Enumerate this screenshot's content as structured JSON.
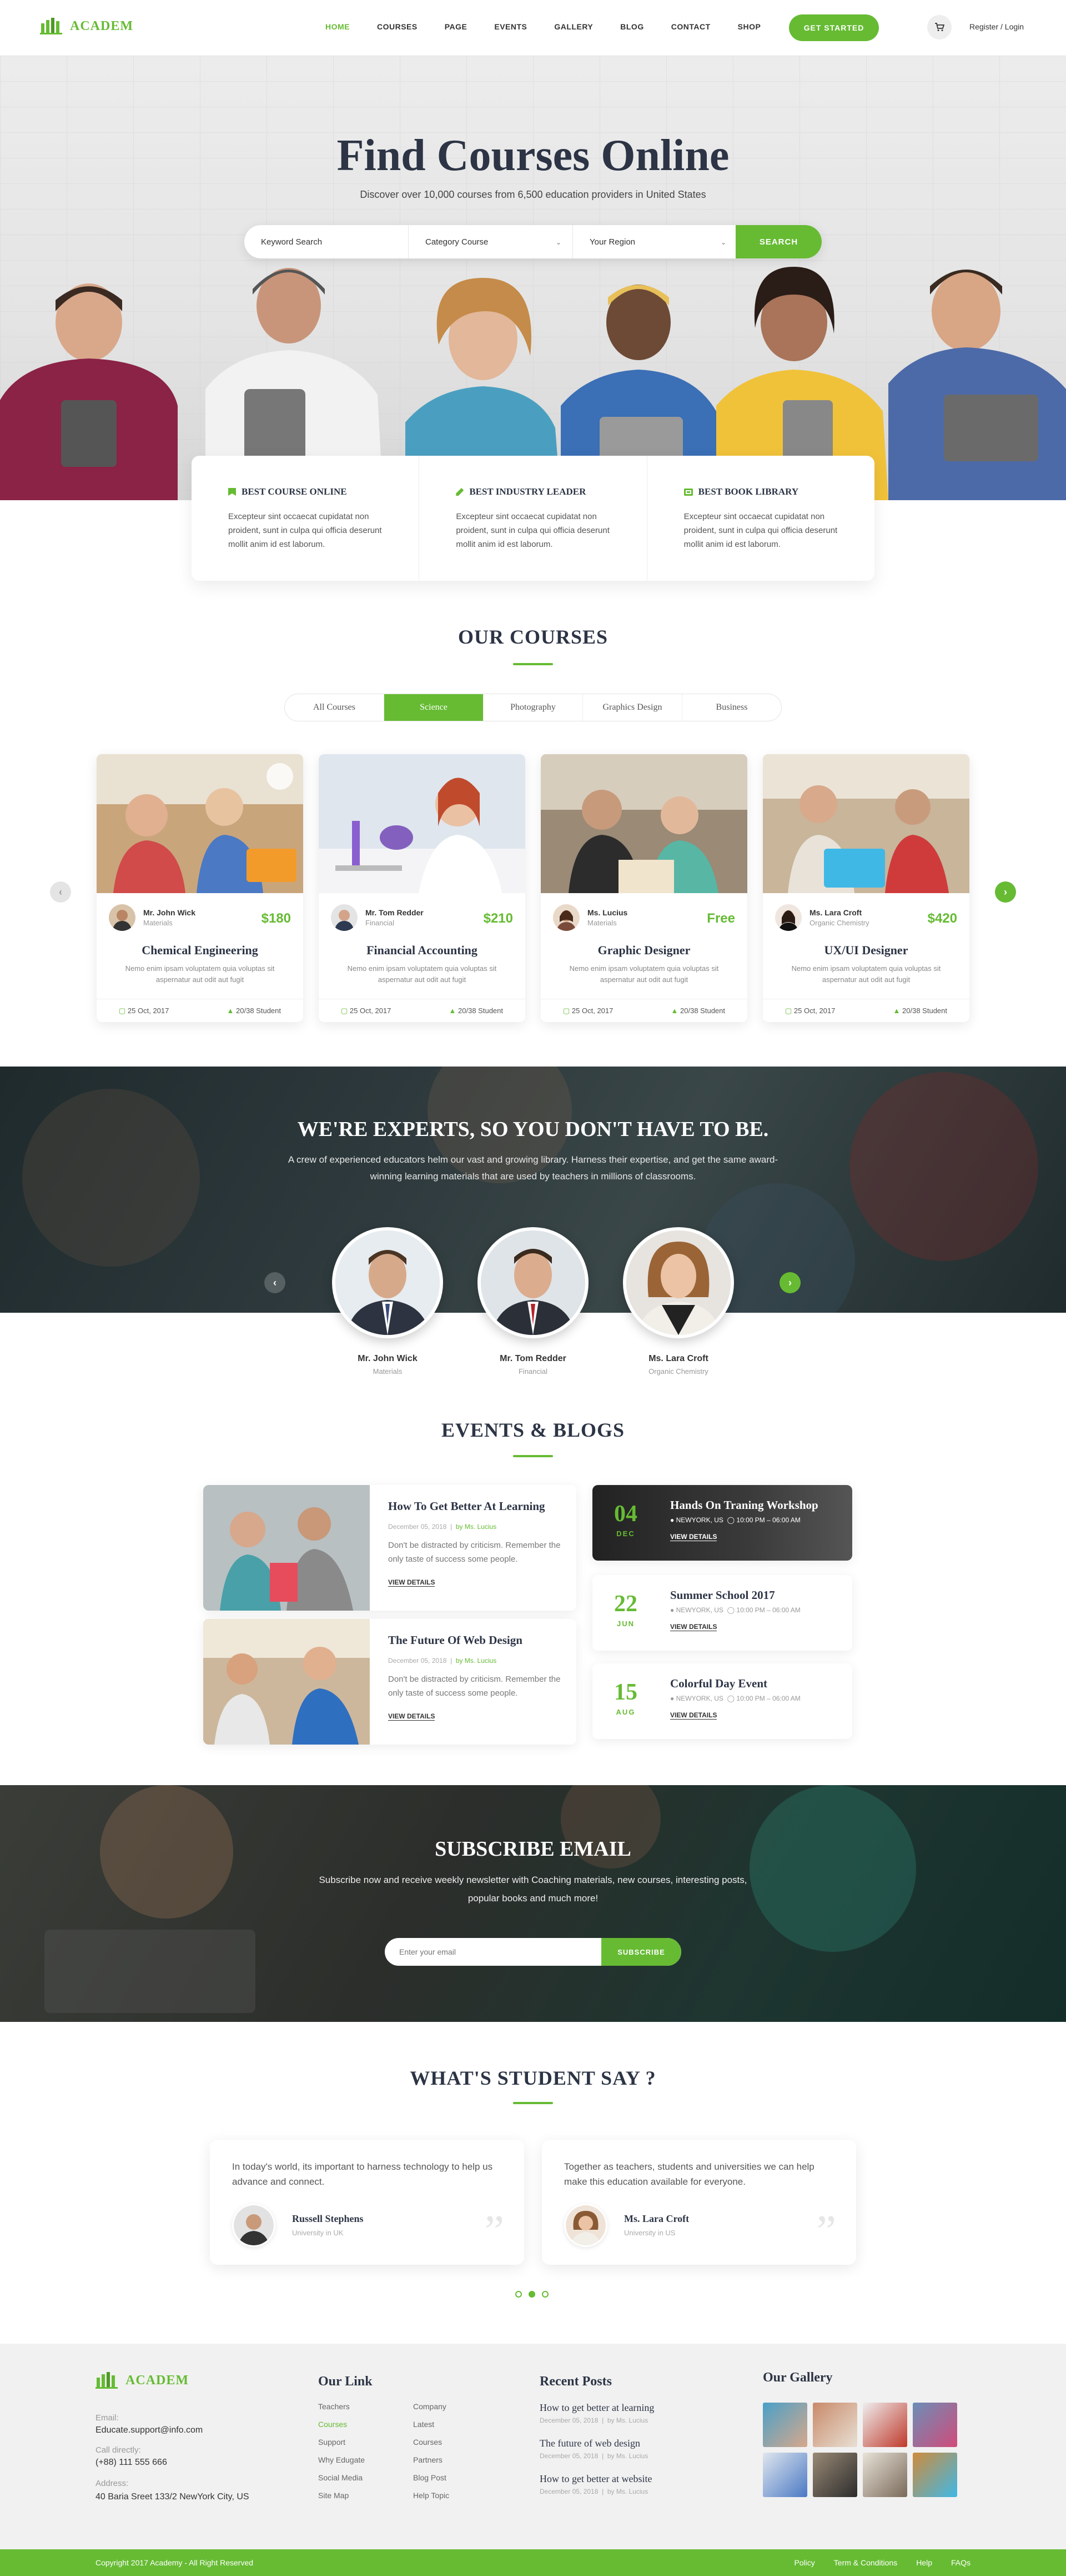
{
  "brand": {
    "name": "ACADEM",
    "accent": "#66bb33",
    "dark": "#2c3445"
  },
  "nav": {
    "items": [
      "HOME",
      "COURSES",
      "PAGE",
      "EVENTS",
      "GALLERY",
      "BLOG",
      "CONTACT",
      "SHOP"
    ],
    "active": "HOME",
    "cta": "GET STARTED",
    "cart_icon": "cart-icon",
    "login": "Register / Login"
  },
  "hero": {
    "title": "Find Courses Online",
    "subtitle": "Discover over 10,000 courses from 6,500 education providers in United States",
    "search": {
      "keyword_placeholder": "Keyword Search",
      "category": "Category Course",
      "region": "Your Region",
      "button": "SEARCH"
    }
  },
  "features": [
    {
      "icon": "badge-icon",
      "title": "BEST COURSE ONLINE",
      "text": "Excepteur sint occaecat cupidatat non proident, sunt in culpa qui officia deserunt mollit anim id est laborum."
    },
    {
      "icon": "pen-icon",
      "title": "BEST INDUSTRY LEADER",
      "text": "Excepteur sint occaecat cupidatat non proident, sunt in culpa qui officia deserunt mollit anim id est laborum."
    },
    {
      "icon": "book-icon",
      "title": "BEST BOOK LIBRARY",
      "text": "Excepteur sint occaecat cupidatat non proident, sunt in culpa qui officia deserunt mollit anim id est laborum."
    }
  ],
  "courses": {
    "title": "OUR COURSES",
    "tabs": [
      "All Courses",
      "Science",
      "Photography",
      "Graphics Design",
      "Business"
    ],
    "active_tab": "Science",
    "items": [
      {
        "author": "Mr. John Wick",
        "role": "Materials",
        "price": "$180",
        "title": "Chemical Engineering",
        "desc": "Nemo enim ipsam voluptatem quia voluptas sit aspernatur aut odit aut fugit",
        "date": "25 Oct, 2017",
        "students": "20/38 Student"
      },
      {
        "author": "Mr. Tom Redder",
        "role": "Financial",
        "price": "$210",
        "title": "Financial Accounting",
        "desc": "Nemo enim ipsam voluptatem quia voluptas sit aspernatur aut odit aut fugit",
        "date": "25 Oct, 2017",
        "students": "20/38 Student"
      },
      {
        "author": "Ms. Lucius",
        "role": "Materials",
        "price": "Free",
        "title": "Graphic Designer",
        "desc": "Nemo enim ipsam voluptatem quia voluptas sit aspernatur aut odit aut fugit",
        "date": "25 Oct, 2017",
        "students": "20/38 Student"
      },
      {
        "author": "Ms. Lara Croft",
        "role": "Organic Chemistry",
        "price": "$420",
        "title": "UX/UI Designer",
        "desc": "Nemo enim ipsam voluptatem quia voluptas sit aspernatur aut odit aut fugit",
        "date": "25 Oct, 2017",
        "students": "20/38 Student"
      }
    ]
  },
  "experts": {
    "title": "WE'RE EXPERTS, SO YOU DON'T HAVE TO BE.",
    "text": "A crew of experienced educators helm our vast and growing library. Harness their expertise, and get the same award-winning learning materials that are used by teachers in millions of classrooms.",
    "people": [
      {
        "name": "Mr. John Wick",
        "role": "Materials"
      },
      {
        "name": "Mr. Tom Redder",
        "role": "Financial"
      },
      {
        "name": "Ms. Lara Croft",
        "role": "Organic Chemistry"
      }
    ]
  },
  "events_blogs": {
    "title": "EVENTS & BLOGS",
    "blogs": [
      {
        "title": "How To Get Better At Learning",
        "date": "December 05, 2018",
        "sep": "|",
        "by": "by Ms. Lucius",
        "text": "Don't be distracted by criticism. Remember the only taste of success some people.",
        "more": "VIEW DETAILS"
      },
      {
        "title": "The Future Of Web Design",
        "date": "December 05, 2018",
        "sep": "|",
        "by": "by Ms. Lucius",
        "text": "Don't be distracted by criticism. Remember the only taste of success some people.",
        "more": "VIEW DETAILS"
      }
    ],
    "events": [
      {
        "day": "04",
        "month": "DEC",
        "title": "Hands On Traning Workshop",
        "location": "NEWYORK, US",
        "time": "10:00 PM – 06:00 AM",
        "more": "VIEW DETAILS"
      },
      {
        "day": "22",
        "month": "JUN",
        "title": "Summer School 2017",
        "location": "NEWYORK, US",
        "time": "10:00 PM – 06:00 AM",
        "more": "VIEW DETAILS"
      },
      {
        "day": "15",
        "month": "AUG",
        "title": "Colorful Day Event",
        "location": "NEWYORK, US",
        "time": "10:00 PM – 06:00 AM",
        "more": "VIEW DETAILS"
      }
    ]
  },
  "subscribe": {
    "title": "SUBSCRIBE EMAIL",
    "text": "Subscribe now and receive weekly newsletter with Coaching materials, new courses, interesting posts, popular books and much more!",
    "placeholder": "Enter your email",
    "button": "SUBSCRIBE"
  },
  "testimonials": {
    "title": "WHAT'S STUDENT SAY ?",
    "items": [
      {
        "text": "In today's world, its important to harness technology to help us advance and connect.",
        "name": "Russell Stephens",
        "loc": "University in UK"
      },
      {
        "text": "Together as teachers, students and universities we can help make this education available for everyone.",
        "name": "Ms. Lara Croft",
        "loc": "University in US"
      }
    ],
    "quote_mark": "”",
    "dots": 3,
    "active_dot": 2
  },
  "footer": {
    "email_label": "Email:",
    "email": "Educate.support@info.com",
    "call_label": "Call directly:",
    "phone": "(+88) 111 555 666",
    "address_label": "Address:",
    "address": "40 Baria Sreet 133/2 NewYork City, US",
    "links_title": "Our Link",
    "links_col1": [
      "Teachers",
      "Courses",
      "Support",
      "Why Edugate",
      "Social Media",
      "Site Map"
    ],
    "links_col2": [
      "Company",
      "Latest",
      "Courses",
      "Partners",
      "Blog Post",
      "Help Topic"
    ],
    "active_link": "Courses",
    "posts_title": "Recent Posts",
    "posts": [
      {
        "title": "How to get better at learning",
        "date": "December 05, 2018",
        "by": "by Ms. Lucius"
      },
      {
        "title": "The future of web design",
        "date": "December 05, 2018",
        "by": "by Ms. Lucius"
      },
      {
        "title": "How to get better at website",
        "date": "December 05, 2018",
        "by": "by Ms. Lucius"
      }
    ],
    "gallery_title": "Our Gallery",
    "copyright": "Copyright 2017 Academy - All Right Reserved",
    "bottom_links": [
      "Policy",
      "Term & Conditions",
      "Help",
      "FAQs"
    ]
  }
}
